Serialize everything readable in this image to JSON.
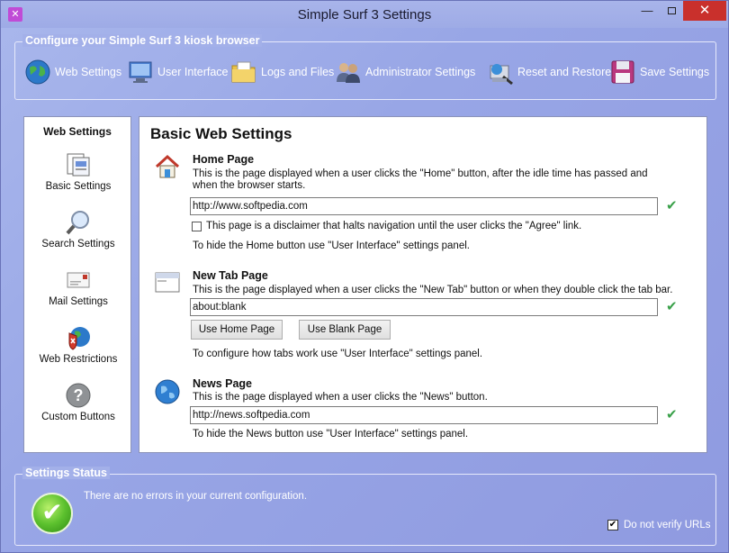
{
  "window": {
    "title": "Simple Surf 3 Settings",
    "minimize": "—",
    "close": "✕"
  },
  "config": {
    "group_title": "Configure your Simple Surf 3 kiosk browser",
    "tools": [
      {
        "label": "Web Settings",
        "icon": "globe-icon"
      },
      {
        "label": "User Interface",
        "icon": "monitor-icon"
      },
      {
        "label": "Logs and Files",
        "icon": "folder-icon"
      },
      {
        "label": "Administrator Settings",
        "icon": "admin-users-icon"
      },
      {
        "label": "Reset and Restore",
        "icon": "reset-icon"
      },
      {
        "label": "Save Settings",
        "icon": "floppy-disk-icon"
      }
    ]
  },
  "nav": {
    "title": "Web Settings",
    "items": [
      {
        "label": "Basic Settings",
        "icon": "pages-icon"
      },
      {
        "label": "Search Settings",
        "icon": "magnifier-icon"
      },
      {
        "label": "Mail Settings",
        "icon": "mail-icon"
      },
      {
        "label": "Web Restrictions",
        "icon": "restricted-globe-icon"
      },
      {
        "label": "Custom Buttons",
        "icon": "question-icon"
      }
    ]
  },
  "main": {
    "heading": "Basic Web Settings",
    "home": {
      "title": "Home Page",
      "desc_line1": "This is the page displayed when a user clicks the \"Home\" button, after the idle time has passed and",
      "desc_line2": "when the browser starts.",
      "url": "http://www.softpedia.com",
      "disclaimer_label": "This page is a disclaimer that halts navigation until the user clicks the \"Agree\" link.",
      "note": "To hide the Home button use \"User Interface\" settings panel."
    },
    "newtab": {
      "title": "New Tab Page",
      "desc": "This is the page displayed when a user clicks the \"New Tab\" button or when they double click the tab bar.",
      "url": "about:blank",
      "use_home_label": "Use Home Page",
      "use_blank_label": "Use Blank Page",
      "note": "To configure how tabs work use \"User Interface\" settings panel."
    },
    "news": {
      "title": "News Page",
      "desc": "This is the page displayed when a user clicks the \"News\" button.",
      "url": "http://news.softpedia.com",
      "note": "To hide the News button use \"User Interface\" settings panel."
    },
    "valid_mark": "✔"
  },
  "status": {
    "group_title": "Settings Status",
    "message": "There are no errors in your current configuration.",
    "verify_label": "Do not verify URLs",
    "verify_checked": "✔",
    "ok_mark": "✔"
  }
}
